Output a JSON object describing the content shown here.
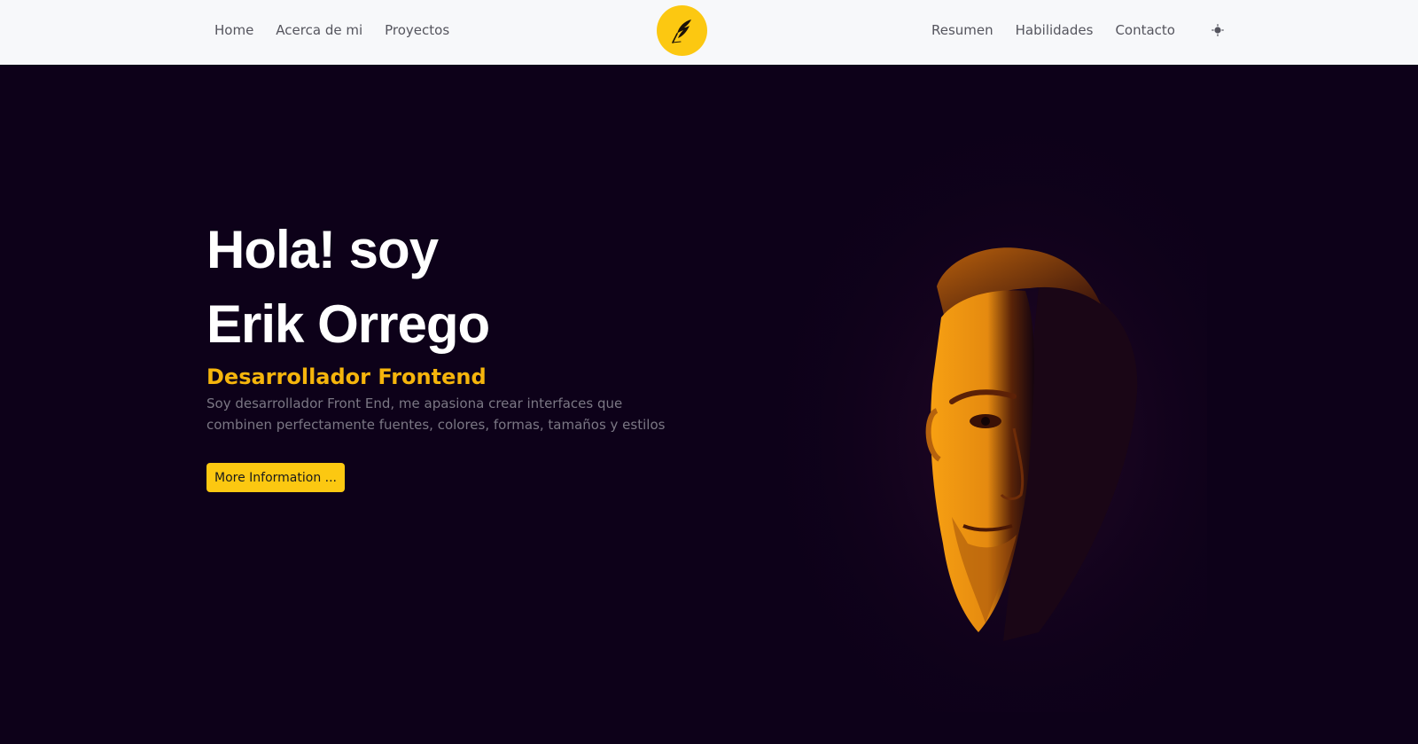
{
  "nav": {
    "left": [
      {
        "label": "Home"
      },
      {
        "label": "Acerca de mi"
      },
      {
        "label": "Proyectos"
      }
    ],
    "right": [
      {
        "label": "Resumen"
      },
      {
        "label": "Habilidades"
      },
      {
        "label": "Contacto"
      }
    ],
    "logo_icon": "feather-quill-icon",
    "theme_icon": "sun-icon"
  },
  "hero": {
    "greeting_line1": "Hola! soy",
    "greeting_line2": "Erik Orrego",
    "role": "Desarrollador Frontend",
    "bio": "Soy desarrollador Front End, me apasiona crear interfaces que combinen perfectamente fuentes, colores, formas, tamaños y estilos",
    "cta_label": "More Information ..."
  },
  "colors": {
    "accent": "#fcc811",
    "background": "#0d0119",
    "nav_background": "#f7f8fa"
  }
}
